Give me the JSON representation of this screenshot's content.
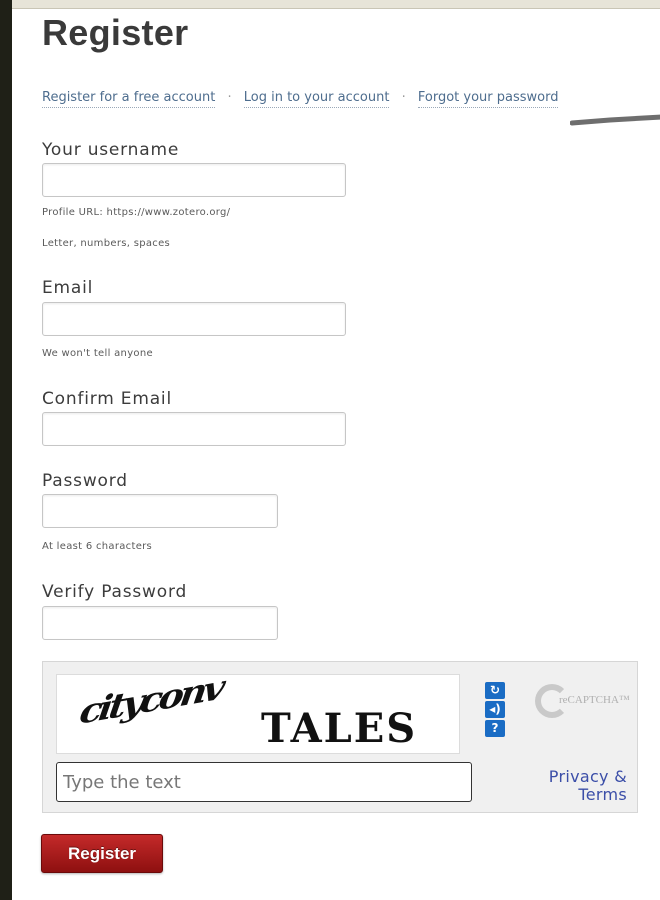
{
  "page": {
    "title": "Register"
  },
  "subnav": {
    "items": [
      "Register for a free account",
      "Log in to your account",
      "Forgot your password"
    ],
    "separator": "·"
  },
  "form": {
    "username": {
      "label": "Your username",
      "value": "",
      "hint_profile_url": "Profile URL: https://www.zotero.org/",
      "hint_allowed": "Letter, numbers, spaces"
    },
    "email": {
      "label": "Email",
      "value": "",
      "hint": "We won't tell anyone"
    },
    "confirm_email": {
      "label": "Confirm Email",
      "value": ""
    },
    "password": {
      "label": "Password",
      "value": "",
      "hint": "At least 6 characters"
    },
    "verify_password": {
      "label": "Verify Password",
      "value": ""
    }
  },
  "captcha": {
    "word1": "cityconv",
    "word2": "TALES",
    "input_placeholder": "Type the text",
    "privacy_line1": "Privacy &",
    "privacy_line2": "Terms",
    "logo_text": "reCAPTCHA™",
    "buttons": [
      "refresh-icon",
      "audio-icon",
      "help-icon"
    ]
  },
  "submit": {
    "label": "Register"
  },
  "colors": {
    "link": "#4e6d8e",
    "button_top": "#c42a2a",
    "button_bottom": "#8e1010",
    "captcha_blue": "#1a6cc4"
  }
}
